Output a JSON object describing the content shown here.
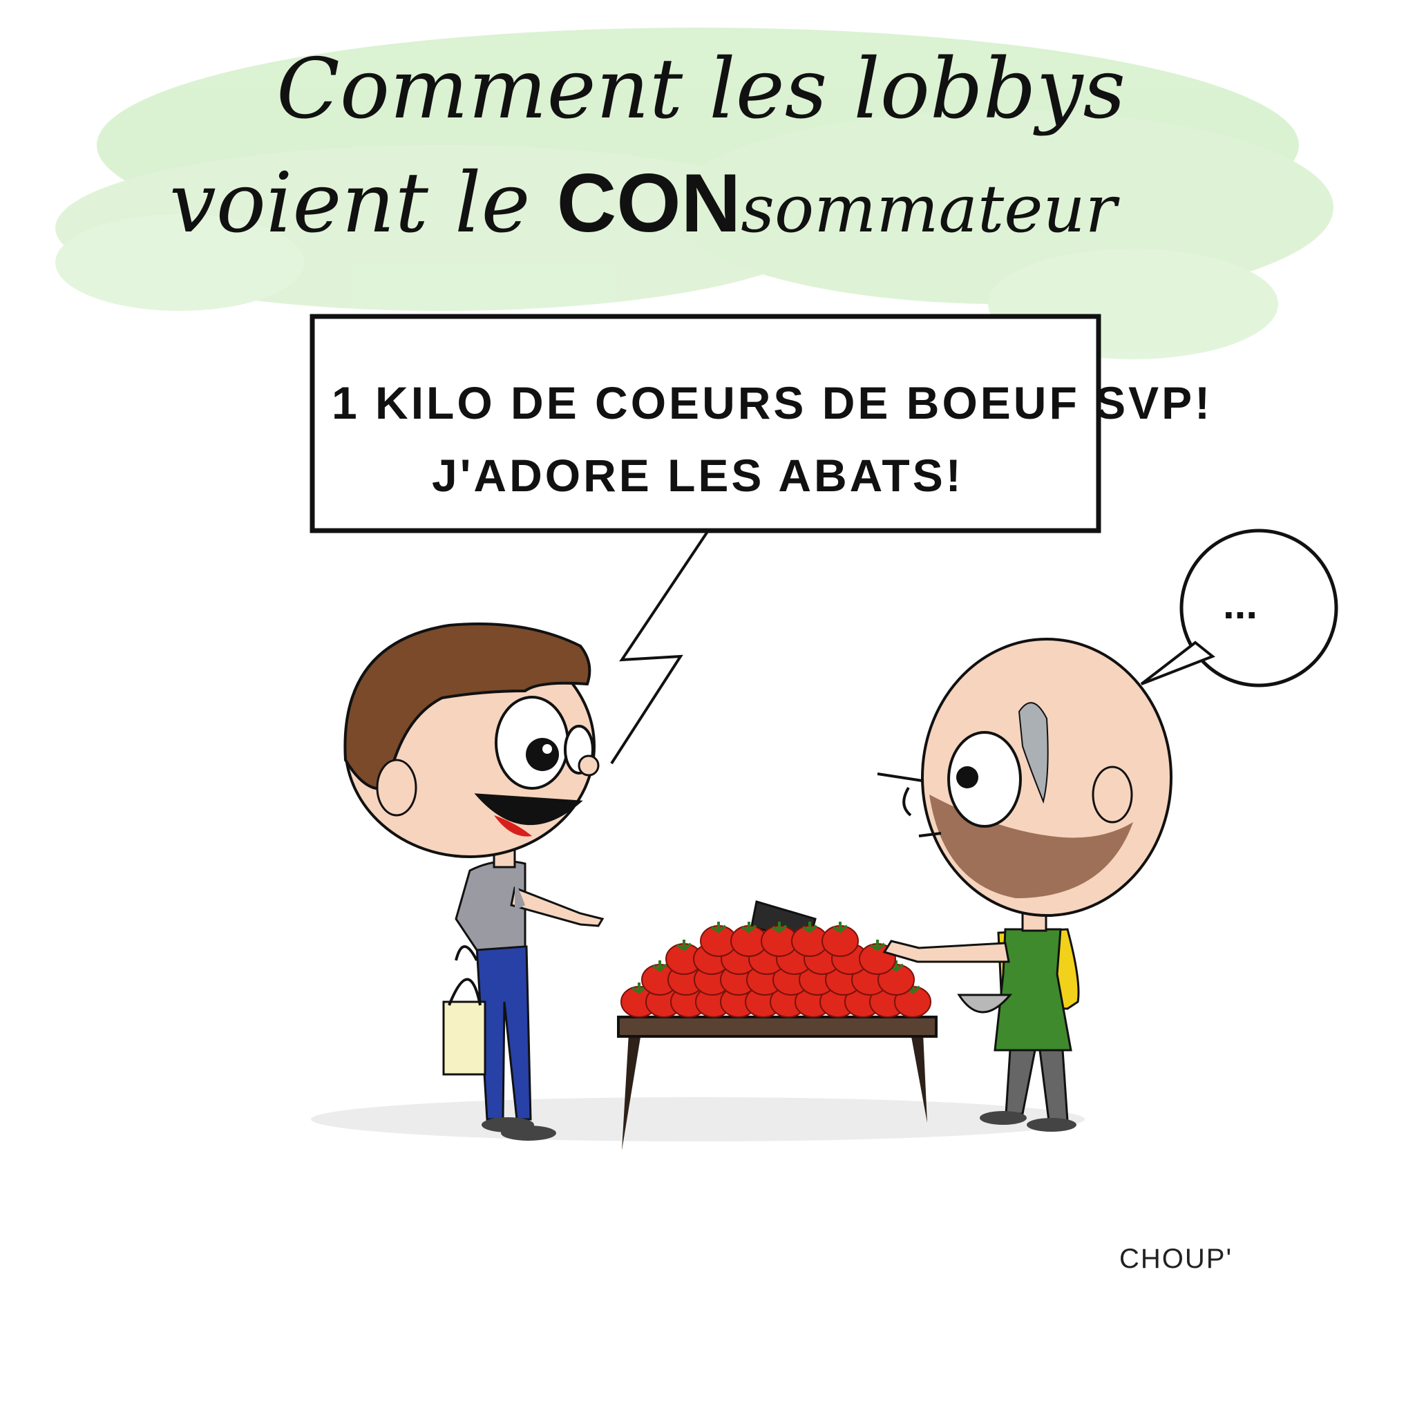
{
  "title": {
    "line1": "Comment les lobbys",
    "line2_start": "voient le ",
    "line2_caps": "CON",
    "line2_end": "sommateur"
  },
  "speech": {
    "line1": "1 KILO DE COEURS DE BOEUF SVP!",
    "line2": "J'ADORE LES ABATS!"
  },
  "vendor_thought": "...",
  "signature": "CHOUP'",
  "colors": {
    "title_wash": "#c9ebbf",
    "customer_hair": "#7a4a2a",
    "tomato": "#e0271b",
    "apron": "#3f8a2c",
    "shirt_yellow": "#f2d11a",
    "skin": "#f6d4be"
  }
}
